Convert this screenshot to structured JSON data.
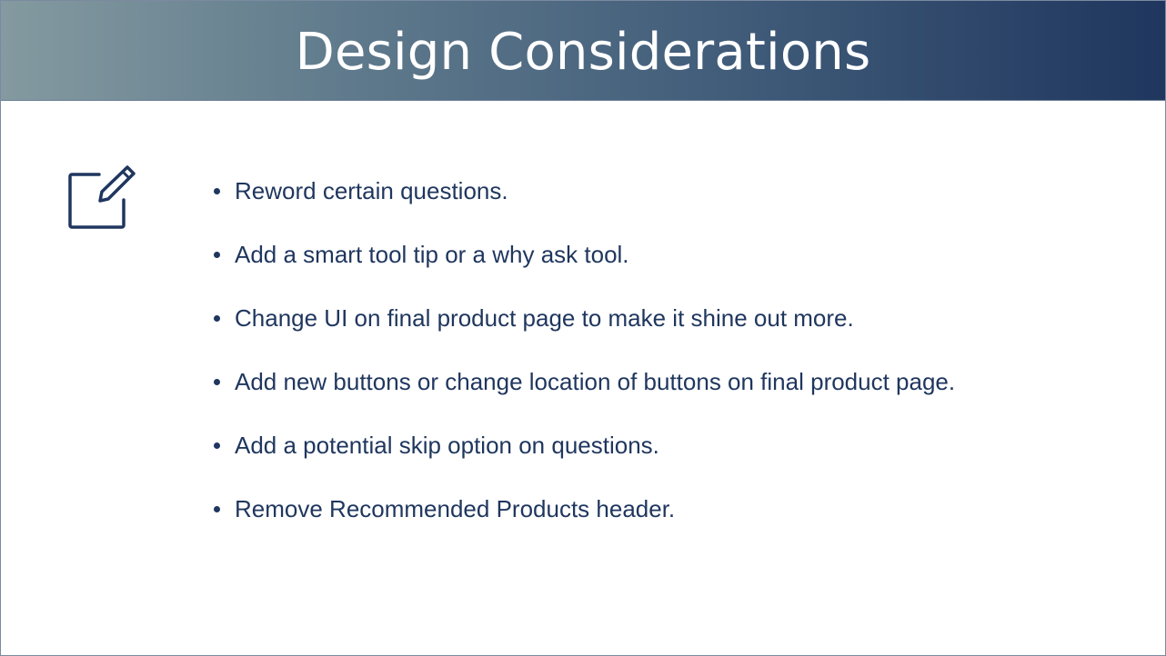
{
  "slide": {
    "title": "Design Considerations",
    "icon": "edit-icon",
    "colors": {
      "header_gradient_start": "#849aa0",
      "header_gradient_end": "#1f365e",
      "text": "#1f365e"
    },
    "bullets": [
      "Reword certain questions.",
      "Add a smart tool tip or a why ask tool.",
      "Change UI on final product page to make it shine out more.",
      "Add new buttons or change location of buttons on final product page.",
      "Add a potential skip option on questions.",
      "Remove Recommended Products header."
    ]
  }
}
